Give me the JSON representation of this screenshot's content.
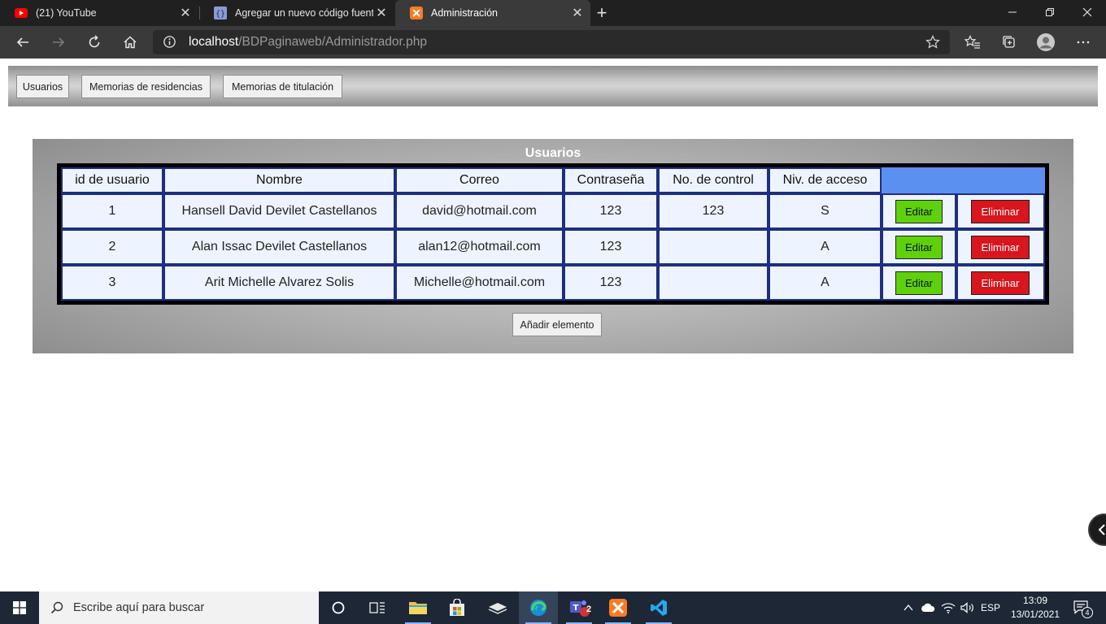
{
  "browser": {
    "tabs": [
      {
        "title": "(21) YouTube",
        "favicon": "youtube-icon",
        "active": false
      },
      {
        "title": "Agregar un nuevo código fuente",
        "favicon": "code-icon",
        "active": false
      },
      {
        "title": "Administración",
        "favicon": "xampp-icon",
        "active": true
      }
    ],
    "url_host": "localhost",
    "url_path": "/BDPaginaweb/Administrador.php"
  },
  "nav": {
    "buttons": [
      "Usuarios",
      "Memorias de residencias",
      "Memorias de titulación"
    ]
  },
  "panel": {
    "title": "Usuarios",
    "columns": [
      "id de usuario",
      "Nombre",
      "Correo",
      "Contraseña",
      "No. de control",
      "Niv. de acceso"
    ],
    "rows": [
      {
        "id": "1",
        "nombre": "Hansell David Devilet Castellanos",
        "correo": "david@hotmail.com",
        "contrasena": "123",
        "control": "123",
        "nivel": "S"
      },
      {
        "id": "2",
        "nombre": "Alan Issac Devilet Castellanos",
        "correo": "alan12@hotmail.com",
        "contrasena": "123",
        "control": "",
        "nivel": "A"
      },
      {
        "id": "3",
        "nombre": "Arit Michelle Alvarez Solis",
        "correo": "Michelle@hotmail.com",
        "contrasena": "123",
        "control": "",
        "nivel": "A"
      }
    ],
    "edit_label": "Editar",
    "delete_label": "Eliminar",
    "add_label": "Añadir elemento"
  },
  "taskbar": {
    "search_placeholder": "Escribe aquí para buscar",
    "teams_badge": "2",
    "language": "ESP",
    "time": "13:09",
    "date": "13/01/2021",
    "notification_count": "4"
  },
  "colors": {
    "header_blue": "#5b8ff0",
    "edit_green": "#5fd10c",
    "delete_red": "#d9151d",
    "cell_border": "#1d2f80",
    "cell_bg": "#eef4ff"
  }
}
